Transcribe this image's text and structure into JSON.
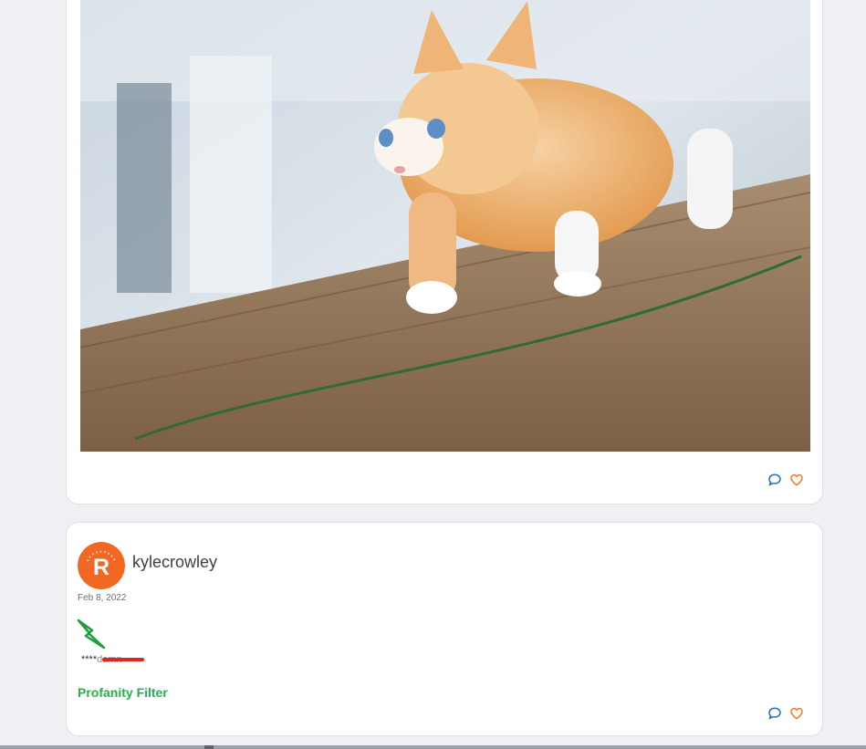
{
  "posts": [
    {
      "image": {
        "subject": "orange-and-white kitten walking on a wooden table"
      },
      "actions": {
        "comment_icon": "speech-bubble-icon",
        "like_icon": "heart-icon"
      }
    },
    {
      "author": {
        "username": "kylecrowley",
        "avatar_letter": "R",
        "avatar_color": "#f26722"
      },
      "date": "Feb 8, 2022",
      "body": {
        "masked": "****",
        "original": "damn"
      },
      "filter_label": "Profanity Filter",
      "actions": {
        "comment_icon": "speech-bubble-icon",
        "like_icon": "heart-icon"
      }
    }
  ],
  "colors": {
    "comment_icon": "#1e6fd9",
    "like_icon": "#f07a2f",
    "filter_label": "#22b24c",
    "strike": "#dc2626"
  }
}
